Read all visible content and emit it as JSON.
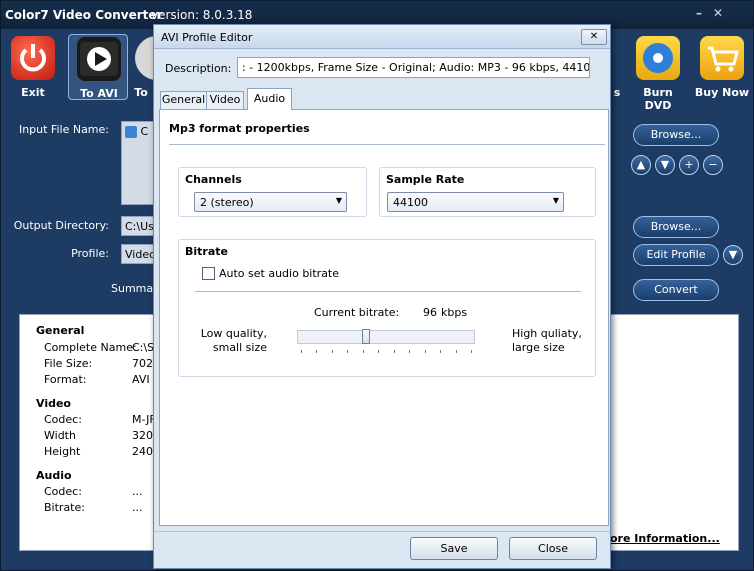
{
  "app": {
    "title": "Color7 Video Converter",
    "version": "version: 8.0.3.18",
    "toolbar": [
      {
        "label": "Exit",
        "icon": "power-icon",
        "color": "#d7281d"
      },
      {
        "label": "To AVI",
        "icon": "film-play-icon",
        "color": "#222222"
      },
      {
        "label": "To",
        "icon": "disc-icon",
        "color": "#c9c9c9"
      },
      {
        "label": "s",
        "icon": "generic-icon",
        "color": "#1d3b63"
      },
      {
        "label": "Burn DVD",
        "icon": "dvd-icon",
        "color": "#f1b51a"
      },
      {
        "label": "Buy Now",
        "icon": "cart-icon",
        "color": "#f1a91a"
      }
    ],
    "labels": {
      "input_file": "Input File Name:",
      "output_dir": "Output Directory:",
      "profile": "Profile:",
      "summary": "Summa"
    },
    "input_file_value": "C",
    "output_dir_value": "C:\\Use",
    "profile_value": "Video",
    "buttons": {
      "browse1": "Browse...",
      "browse2": "Browse...",
      "edit_profile": "Edit Profile",
      "convert": "Convert",
      "up": "▲",
      "down": "▼",
      "add": "+",
      "remove": "−",
      "profile_dropdown": "▼"
    },
    "info": {
      "general_heading": "General",
      "general": [
        {
          "key": "Complete Name:",
          "value": "C:\\S"
        },
        {
          "key": "File Size:",
          "value": "7029"
        },
        {
          "key": "Format:",
          "value": "AVI"
        }
      ],
      "video_heading": "Video",
      "video": [
        {
          "key": "Codec:",
          "value": "M-JF"
        },
        {
          "key": "Width",
          "value": "320"
        },
        {
          "key": "Height",
          "value": "240"
        }
      ],
      "audio_heading": "Audio",
      "audio": [
        {
          "key": "Codec:",
          "value": "..."
        },
        {
          "key": "Bitrate:",
          "value": "..."
        }
      ],
      "more_info": "ore Information..."
    },
    "window_controls": {
      "minimize": "–",
      "close": "✕"
    }
  },
  "dialog": {
    "title": "AVI Profile Editor",
    "close_glyph": "✕",
    "description_label": "Description:",
    "description_value": ": - 1200kbps, Frame Size - Original; Audio: MP3 - 96 kbps, 44100, Stereo",
    "tabs": [
      "General",
      "Video",
      "Audio"
    ],
    "active_tab": "Audio",
    "mp3_title": "Mp3 format properties",
    "channels": {
      "label": "Channels",
      "value": "2 (stereo)"
    },
    "sample_rate": {
      "label": "Sample Rate",
      "value": "44100"
    },
    "bitrate": {
      "label": "Bitrate",
      "auto_label": "Auto set audio bitrate",
      "auto_checked": false,
      "current_label": "Current bitrate:",
      "current_value": "96",
      "unit": "kbps",
      "low_label_1": "Low quality,",
      "low_label_2": "small size",
      "high_label_1": "High quliaty,",
      "high_label_2": "large size",
      "slider_fraction": 0.38
    },
    "save": "Save",
    "close": "Close"
  }
}
